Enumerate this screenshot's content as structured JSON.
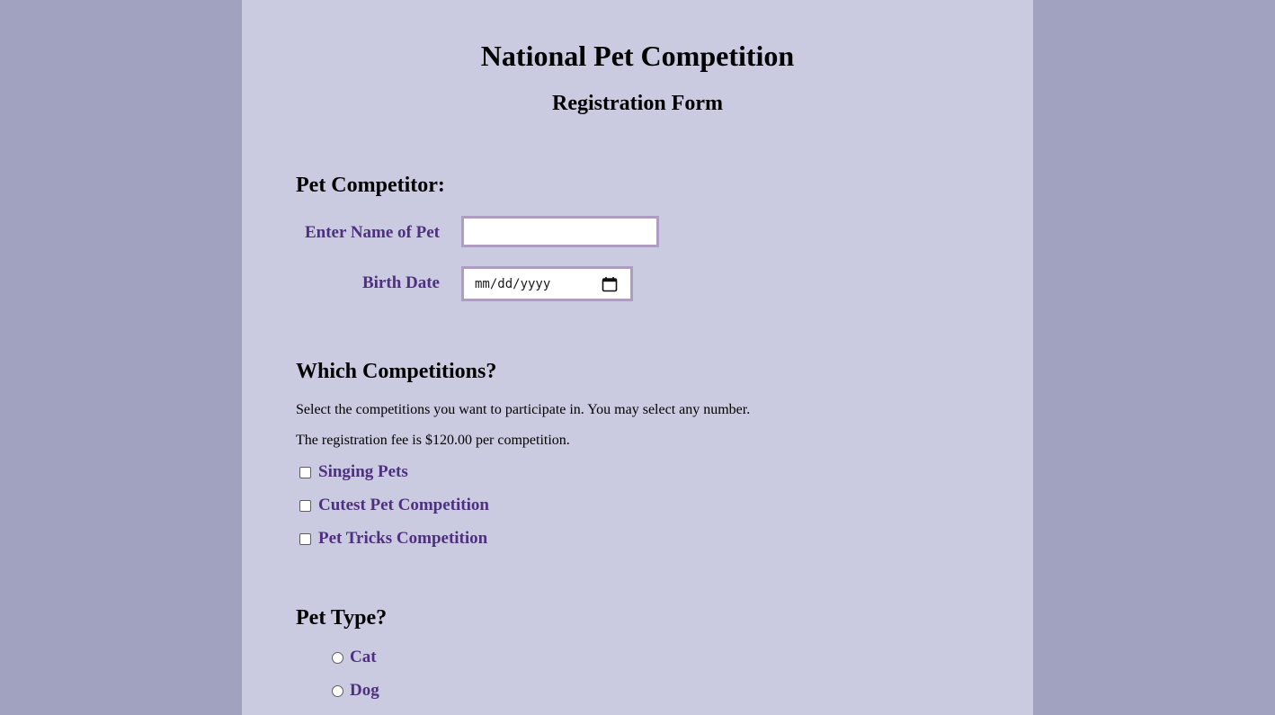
{
  "header": {
    "title": "National Pet Competition",
    "subtitle": "Registration Form"
  },
  "competitor": {
    "heading": "Pet Competitor:",
    "name_label": "Enter Name of Pet",
    "name_value": "",
    "birth_label": "Birth Date",
    "birth_placeholder": "mm/dd/yyyy"
  },
  "competitions": {
    "heading": "Which Competitions?",
    "instructions": "Select the competitions you want to participate in. You may select any number.",
    "fee_note": "The registration fee is $120.00 per competition.",
    "options": [
      {
        "label": "Singing Pets",
        "checked": false
      },
      {
        "label": "Cutest Pet Competition",
        "checked": false
      },
      {
        "label": "Pet Tricks Competition",
        "checked": false
      }
    ]
  },
  "pet_type": {
    "heading": "Pet Type?",
    "options": [
      {
        "label": "Cat",
        "selected": false
      },
      {
        "label": "Dog",
        "selected": false
      }
    ]
  },
  "colors": {
    "outer_background": "#a0a2bf",
    "form_background": "#cacbe0",
    "label_purple": "#4f2f80",
    "input_border": "#ae9cc2"
  },
  "icons": {
    "date_picker": "calendar-icon"
  }
}
